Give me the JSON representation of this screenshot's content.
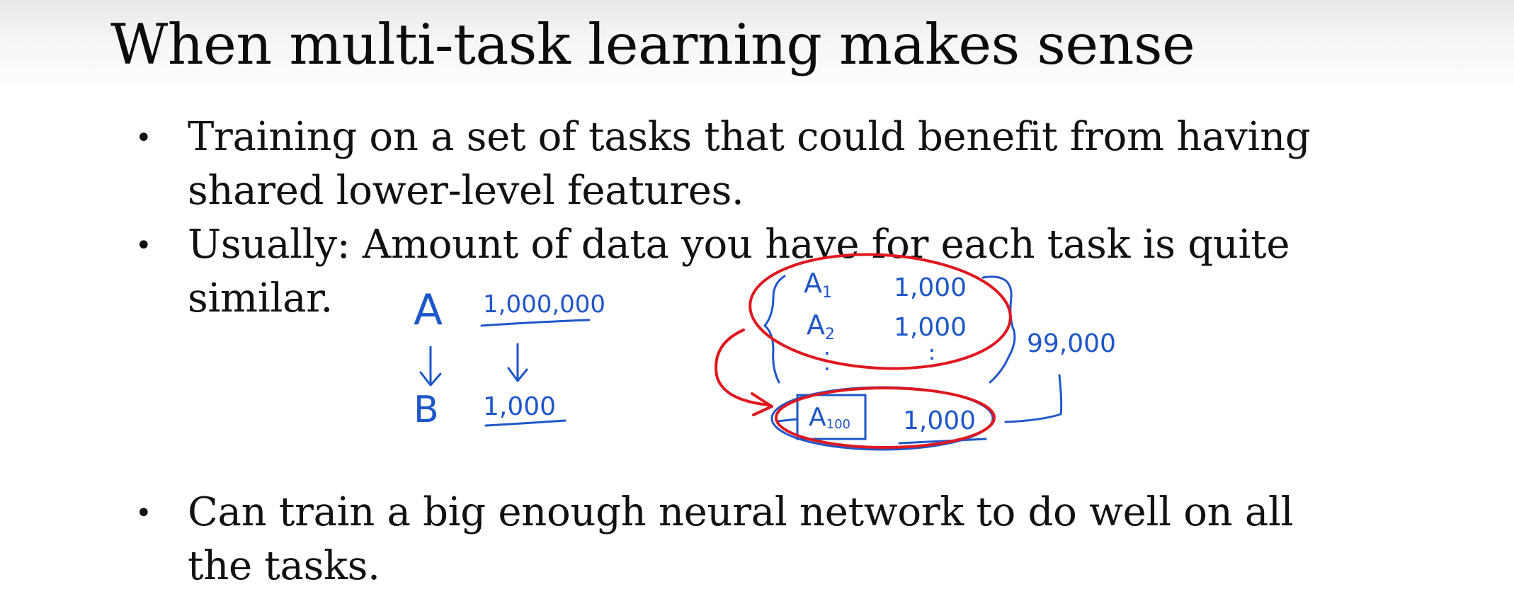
{
  "slide": {
    "title": "When multi-task learning makes sense",
    "bullets": [
      {
        "symbol": "•",
        "lines": [
          "Training on a set of tasks that could benefit from having",
          "shared lower-level features."
        ]
      },
      {
        "symbol": "•",
        "lines": [
          "Usually: Amount of data you have for each task is quite",
          "similar."
        ]
      },
      {
        "symbol": "•",
        "lines": [
          "Can train a big enough neural network to do well on all",
          "the tasks."
        ]
      }
    ]
  },
  "annotations": {
    "left": {
      "task_a": "A",
      "task_a_count": "1,000,000",
      "task_b": "B",
      "task_b_count": "1,000"
    },
    "right": {
      "a1": "A",
      "a1_sub": "1",
      "a1_count": "1,000",
      "a2": "A",
      "a2_sub": "2",
      "a2_count": "1,000",
      "total": "99,000",
      "a100": "A",
      "a100_sub": "100",
      "a100_count": "1,000"
    },
    "colors": {
      "blue_ink": "#1f57c9",
      "red_ink": "#e0171f"
    }
  }
}
